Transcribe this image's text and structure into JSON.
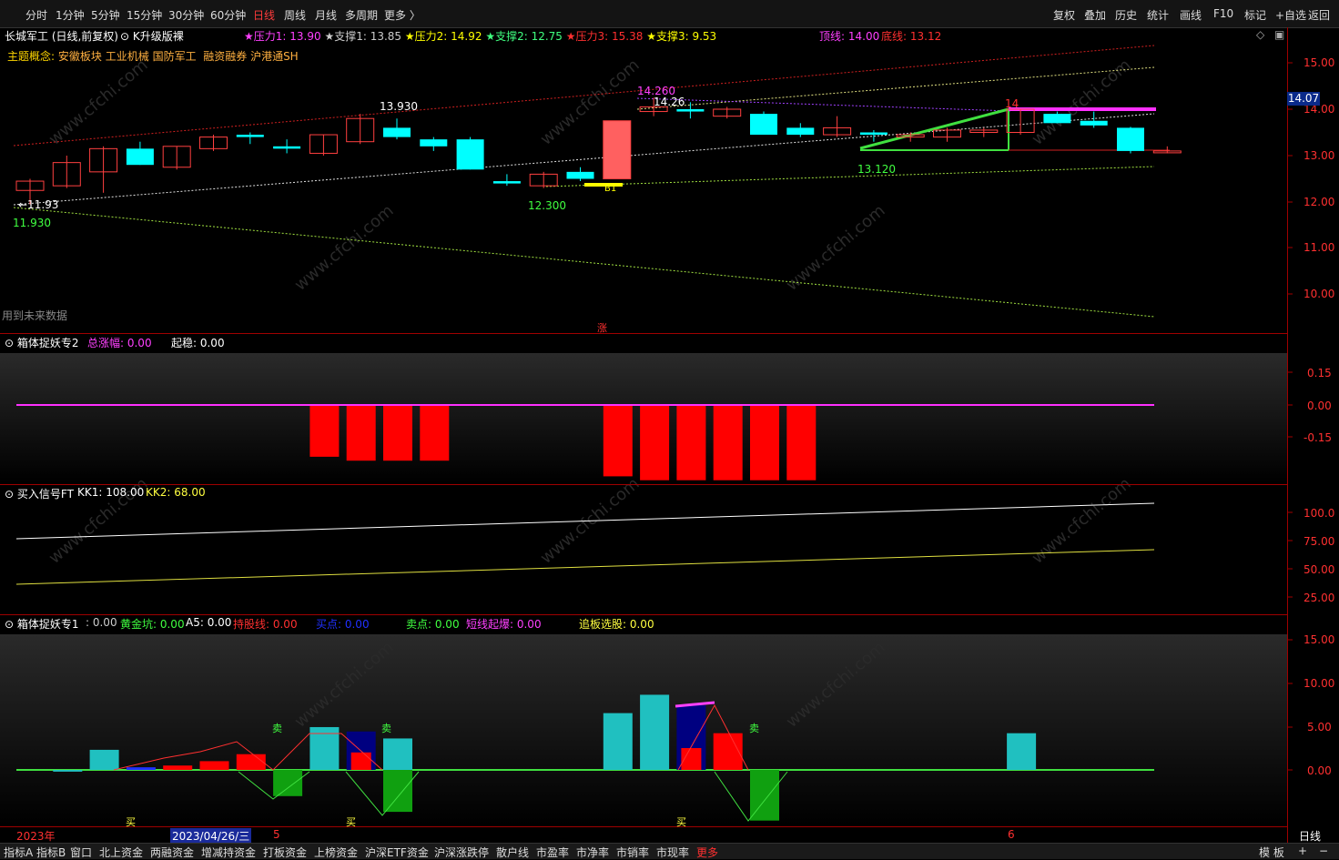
{
  "periods": [
    "分时",
    "1分钟",
    "5分钟",
    "15分钟",
    "30分钟",
    "60分钟",
    "日线",
    "周线",
    "月线",
    "多周期",
    "更多 〉"
  ],
  "active_period": "日线",
  "right_tools": [
    "复权",
    "叠加",
    "历史",
    "统计",
    "画线",
    "F10",
    "标记",
    "+自选",
    "返回"
  ],
  "stock_title": "长城军工 (日线,前复权)",
  "indicator_name": "K升级版裸",
  "pressure_support": [
    {
      "text": "★压力1: 13.90",
      "color": "#ff40ff"
    },
    {
      "text": "★支撑1: 13.85",
      "color": "#cccccc"
    },
    {
      "text": "★压力2: 14.92",
      "color": "#ffff00"
    },
    {
      "text": "★支撑2: 12.75",
      "color": "#40ff80"
    },
    {
      "text": "★压力3: 15.38",
      "color": "#ff3030"
    },
    {
      "text": "★支撑3: 9.53",
      "color": "#ffff00"
    }
  ],
  "top_line": "顶线: 14.00",
  "bottom_line": "底线: 13.12",
  "concept_label": "主题概念:",
  "concepts": [
    "安徽板块",
    "工业机械",
    "国防军工",
    "融资融券",
    "沪港通SH"
  ],
  "future_data_note": "用到未来数据",
  "zhang_mark": "涨",
  "price_axis": [
    "15.00",
    "14.00",
    "13.00",
    "12.00",
    "11.00",
    "10.00"
  ],
  "current_price": "14.07",
  "annotations": {
    "a1": "←11.93",
    "a2": "11.930",
    "a3": "13.930",
    "a4": "12.300",
    "a5": "B1",
    "a6": "14.260",
    "a7": "14.26",
    "a8": "13.120",
    "a9": "14"
  },
  "panel2": {
    "name": "箱体捉妖专2",
    "f1": "总涨幅: 0.00",
    "f2": "起稳: 0.00",
    "axis": [
      "0.15",
      "0.00",
      "-0.15"
    ]
  },
  "panel3": {
    "name": "买入信号FT",
    "f1": "KK1: 108.00",
    "f2": "KK2: 68.00",
    "axis": [
      "100.0",
      "75.00",
      "50.00",
      "25.00"
    ]
  },
  "panel4": {
    "name": "箱体捉妖专1",
    "fields": [
      {
        "text": ": 0.00",
        "color": "#ffffff"
      },
      {
        "text": "黄金坑: 0.00",
        "color": "#40ff40"
      },
      {
        "text": "A5: 0.00",
        "color": "#ffffff"
      },
      {
        "text": "持股线: 0.00",
        "color": "#ff3030"
      },
      {
        "text": "买点: 0.00",
        "color": "#2030ff"
      },
      {
        "text": "卖点: 0.00",
        "color": "#40ff40"
      },
      {
        "text": "短线起爆: 0.00",
        "color": "#ff40ff"
      },
      {
        "text": "追板选股: 0.00",
        "color": "#ffff40"
      }
    ],
    "axis": [
      "15.00",
      "10.00",
      "5.00",
      "0.00"
    ],
    "buy": "买",
    "sell": "卖"
  },
  "dates": {
    "year": "2023年",
    "cursor": "2023/04/26/三",
    "m5": "5",
    "m6": "6"
  },
  "period_label": "日线",
  "bottom_tabs": [
    "指标A",
    "指标B",
    "窗口",
    "北上资金",
    "两融资金",
    "增减持资金",
    "打板资金",
    "上榜资金",
    "沪深ETF资金",
    "沪深涨跌停",
    "散户线",
    "市盈率",
    "市净率",
    "市销率",
    "市现率",
    "更多"
  ],
  "bottom_right": [
    "模 板",
    "+",
    "−"
  ],
  "watermark": "www.cfchi.com",
  "chart_data": {
    "type": "candlestick",
    "ylim": [
      9.5,
      15.3
    ],
    "candles": [
      {
        "o": 12.25,
        "h": 12.5,
        "l": 11.95,
        "c": 12.45,
        "col": "up"
      },
      {
        "o": 12.35,
        "h": 13.0,
        "l": 12.3,
        "c": 12.85,
        "col": "up"
      },
      {
        "o": 12.65,
        "h": 13.2,
        "l": 12.2,
        "c": 13.15,
        "col": "up"
      },
      {
        "o": 13.15,
        "h": 13.3,
        "l": 12.8,
        "c": 12.8,
        "col": "dn"
      },
      {
        "o": 12.75,
        "h": 13.2,
        "l": 12.7,
        "c": 13.2,
        "col": "up"
      },
      {
        "o": 13.15,
        "h": 13.45,
        "l": 13.1,
        "c": 13.4,
        "col": "up"
      },
      {
        "o": 13.45,
        "h": 13.5,
        "l": 13.25,
        "c": 13.4,
        "col": "dn"
      },
      {
        "o": 13.2,
        "h": 13.35,
        "l": 13.05,
        "c": 13.15,
        "col": "dn"
      },
      {
        "o": 13.05,
        "h": 13.45,
        "l": 13.0,
        "c": 13.45,
        "col": "up"
      },
      {
        "o": 13.3,
        "h": 13.9,
        "l": 13.25,
        "c": 13.8,
        "col": "up"
      },
      {
        "o": 13.6,
        "h": 13.8,
        "l": 13.35,
        "c": 13.4,
        "col": "dn"
      },
      {
        "o": 13.35,
        "h": 13.4,
        "l": 13.1,
        "c": 13.2,
        "col": "dn"
      },
      {
        "o": 13.35,
        "h": 13.4,
        "l": 12.7,
        "c": 12.7,
        "col": "dn"
      },
      {
        "o": 12.45,
        "h": 12.6,
        "l": 12.35,
        "c": 12.4,
        "col": "dn"
      },
      {
        "o": 12.35,
        "h": 12.65,
        "l": 12.3,
        "c": 12.6,
        "col": "up"
      },
      {
        "o": 12.5,
        "h": 12.75,
        "l": 12.45,
        "c": 12.65,
        "col": "dn"
      },
      {
        "o": 12.5,
        "h": 13.75,
        "l": 12.5,
        "c": 13.75,
        "col": "up"
      },
      {
        "o": 13.95,
        "h": 14.25,
        "l": 13.85,
        "c": 14.05,
        "col": "up"
      },
      {
        "o": 14.0,
        "h": 14.15,
        "l": 13.8,
        "c": 13.95,
        "col": "dn"
      },
      {
        "o": 13.85,
        "h": 14.05,
        "l": 13.8,
        "c": 14.0,
        "col": "up"
      },
      {
        "o": 13.9,
        "h": 13.95,
        "l": 13.45,
        "c": 13.45,
        "col": "dn"
      },
      {
        "o": 13.6,
        "h": 13.7,
        "l": 13.4,
        "c": 13.45,
        "col": "dn"
      },
      {
        "o": 13.45,
        "h": 13.85,
        "l": 13.4,
        "c": 13.6,
        "col": "up"
      },
      {
        "o": 13.5,
        "h": 13.55,
        "l": 13.3,
        "c": 13.45,
        "col": "dn"
      },
      {
        "o": 13.4,
        "h": 13.5,
        "l": 13.3,
        "c": 13.45,
        "col": "up"
      },
      {
        "o": 13.4,
        "h": 13.6,
        "l": 13.3,
        "c": 13.55,
        "col": "up"
      },
      {
        "o": 13.5,
        "h": 13.6,
        "l": 13.4,
        "c": 13.55,
        "col": "up"
      },
      {
        "o": 13.5,
        "h": 14.0,
        "l": 13.45,
        "c": 14.0,
        "col": "up"
      },
      {
        "o": 13.9,
        "h": 13.95,
        "l": 13.7,
        "c": 13.7,
        "col": "dn"
      },
      {
        "o": 13.75,
        "h": 13.95,
        "l": 13.6,
        "c": 13.65,
        "col": "dn"
      },
      {
        "o": 13.6,
        "h": 13.62,
        "l": 13.05,
        "c": 13.1,
        "col": "dn"
      },
      {
        "o": 13.1,
        "h": 13.2,
        "l": 13.05,
        "c": 13.1,
        "col": "up"
      }
    ],
    "panel2_bars": [
      0,
      0,
      0,
      0,
      0,
      0,
      0,
      0,
      -0.13,
      -0.14,
      -0.14,
      -0.14,
      0,
      0,
      0,
      0,
      -0.18,
      -0.19,
      -0.19,
      -0.19,
      -0.19,
      -0.19,
      0,
      0,
      0,
      0,
      0,
      0,
      0,
      0,
      0,
      0
    ],
    "panel4_bars": [
      {
        "i": 1,
        "v": -0.2,
        "c": "#20c0c0"
      },
      {
        "i": 2,
        "v": 2.3,
        "c": "#20c0c0"
      },
      {
        "i": 3,
        "v": 0.3,
        "c": "#2030ff"
      },
      {
        "i": 4,
        "v": 0.5,
        "c": "#ff0000"
      },
      {
        "i": 5,
        "v": 1.0,
        "c": "#ff0000"
      },
      {
        "i": 6,
        "v": 1.8,
        "c": "#ff0000"
      },
      {
        "i": 7,
        "v": -3.0,
        "c": "#10a010"
      },
      {
        "i": 8,
        "v": 4.9,
        "c": "#20c0c0"
      },
      {
        "i": 9,
        "v": 4.4,
        "c": "#000080"
      },
      {
        "i": 10,
        "v": 3.6,
        "c": "#20c0c0"
      },
      {
        "i": 10,
        "v": -4.8,
        "c": "#10a010"
      },
      {
        "i": 16,
        "v": 6.5,
        "c": "#20c0c0"
      },
      {
        "i": 17,
        "v": 8.6,
        "c": "#20c0c0"
      },
      {
        "i": 18,
        "v": 7.4,
        "c": "#000080"
      },
      {
        "i": 19,
        "v": 4.2,
        "c": "#ff0000"
      },
      {
        "i": 20,
        "v": -5.8,
        "c": "#10a010"
      },
      {
        "i": 27,
        "v": 4.2,
        "c": "#20c0c0"
      }
    ],
    "panel4_red_bar": [
      {
        "i": 9,
        "v": 2.0
      },
      {
        "i": 18,
        "v": 2.5
      }
    ]
  }
}
